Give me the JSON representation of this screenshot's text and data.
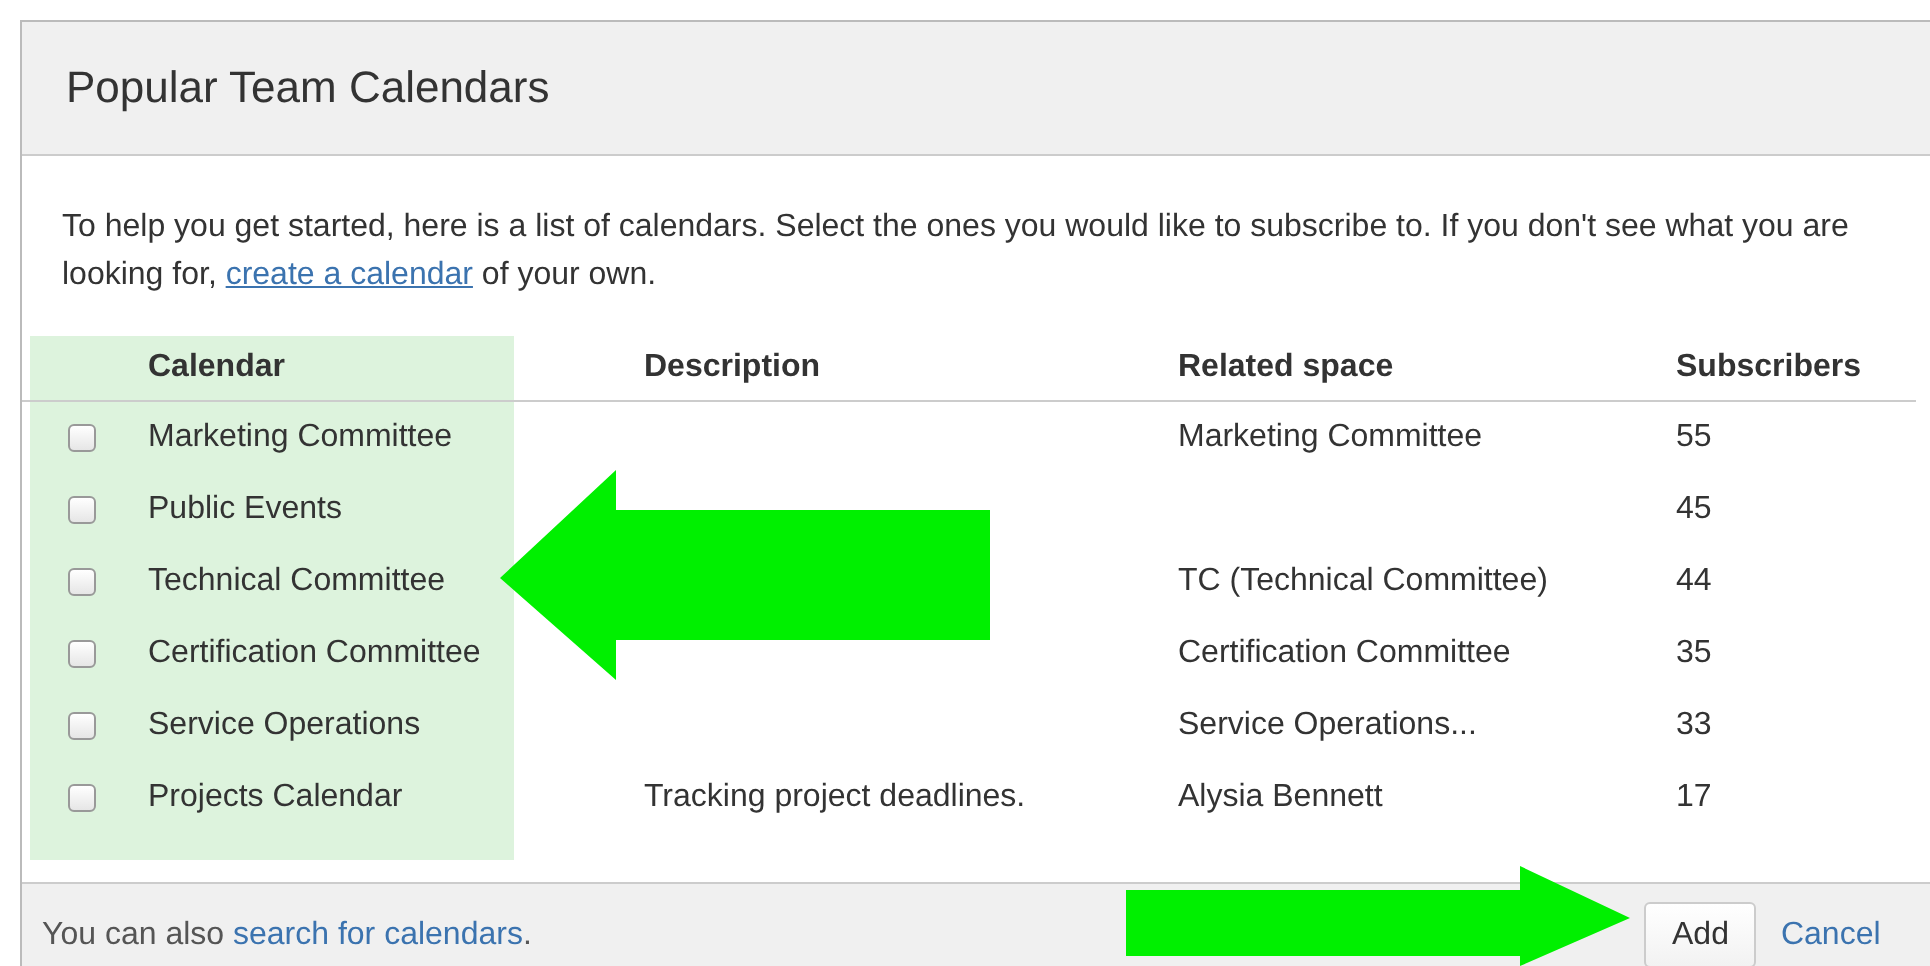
{
  "dialog": {
    "title": "Popular Team Calendars",
    "intro": {
      "before": "To help you get started, here is a list of calendars. Select the ones you would like to subscribe to. If you don't see what you are looking for, ",
      "link": "create a calendar",
      "after": " of your own."
    }
  },
  "table": {
    "columns": [
      "Calendar",
      "Description",
      "Related space",
      "Subscribers"
    ],
    "rows": [
      {
        "checked": false,
        "calendar": "Marketing Committee",
        "description": "",
        "related_space": "Marketing Committee",
        "subscribers": "55"
      },
      {
        "checked": false,
        "calendar": "Public Events",
        "description": "",
        "related_space": "",
        "subscribers": "45"
      },
      {
        "checked": false,
        "calendar": "Technical Committee",
        "description": "",
        "related_space": "TC (Technical Committee)",
        "subscribers": "44"
      },
      {
        "checked": false,
        "calendar": "Certification Committee",
        "description": "",
        "related_space": "Certification Committee",
        "subscribers": "35"
      },
      {
        "checked": false,
        "calendar": "Service Operations",
        "description": "",
        "related_space": "Service Operations...",
        "subscribers": "33"
      },
      {
        "checked": false,
        "calendar": "Projects Calendar",
        "description": "Tracking project deadlines.",
        "related_space": "Alysia Bennett",
        "subscribers": "17"
      }
    ]
  },
  "footer": {
    "before": "You can also ",
    "link": "search for calendars",
    "after": ".",
    "buttons": [
      {
        "label": "Add",
        "kind": "button"
      },
      {
        "label": "Cancel",
        "kind": "link"
      }
    ]
  }
}
